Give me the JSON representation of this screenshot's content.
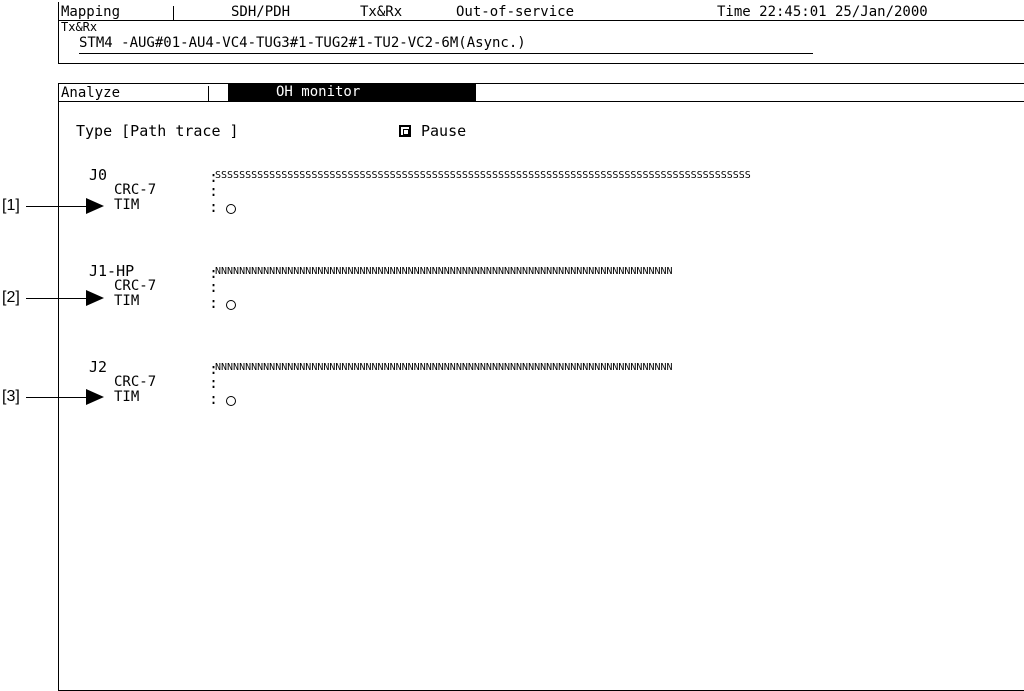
{
  "header": {
    "mapping": "Mapping",
    "mode": "SDH/PDH",
    "direction": "Tx&Rx",
    "service": "Out-of-service",
    "time": "Time 22:45:01 25/Jan/2000",
    "sub_label": "Tx&Rx",
    "path": "STM4 -AUG#01-AU4-VC4-TUG3#1-TUG2#1-TU2-VC2-6M(Async.)"
  },
  "tabs": {
    "analyze": "Analyze",
    "oh_monitor": "OH monitor"
  },
  "type_line": "Type [Path trace ]",
  "pause_label": "Pause",
  "rows": [
    {
      "name": "J0",
      "sep": ":",
      "value": "SSSSSSSSSSSSSSSSSSSSSSSSSSSSSSSSSSSSSSSSSSSSSSSSSSSSSSSSSSSSSSSSSSSSSSSSSSSSSSSSSSSSSSSSS",
      "crc_label": "CRC-7",
      "crc_sep": ":",
      "tim_label": "TIM",
      "tim_sep": ":",
      "callout": "[1]"
    },
    {
      "name": "J1-HP",
      "sep": ":",
      "value": "NNNNNNNNNNNNNNNNNNNNNNNNNNNNNNNNNNNNNNNNNNNNNNNNNNNNNNNNNNNNNNNNNNNNNNNNNNNN",
      "crc_label": "CRC-7",
      "crc_sep": ":",
      "tim_label": "TIM",
      "tim_sep": ":",
      "callout": "[2]"
    },
    {
      "name": "J2",
      "sep": ":",
      "value": "NNNNNNNNNNNNNNNNNNNNNNNNNNNNNNNNNNNNNNNNNNNNNNNNNNNNNNNNNNNNNNNNNNNNNNNNNNNN",
      "crc_label": "CRC-7",
      "crc_sep": ":",
      "tim_label": "TIM",
      "tim_sep": ":",
      "callout": "[3]"
    }
  ]
}
